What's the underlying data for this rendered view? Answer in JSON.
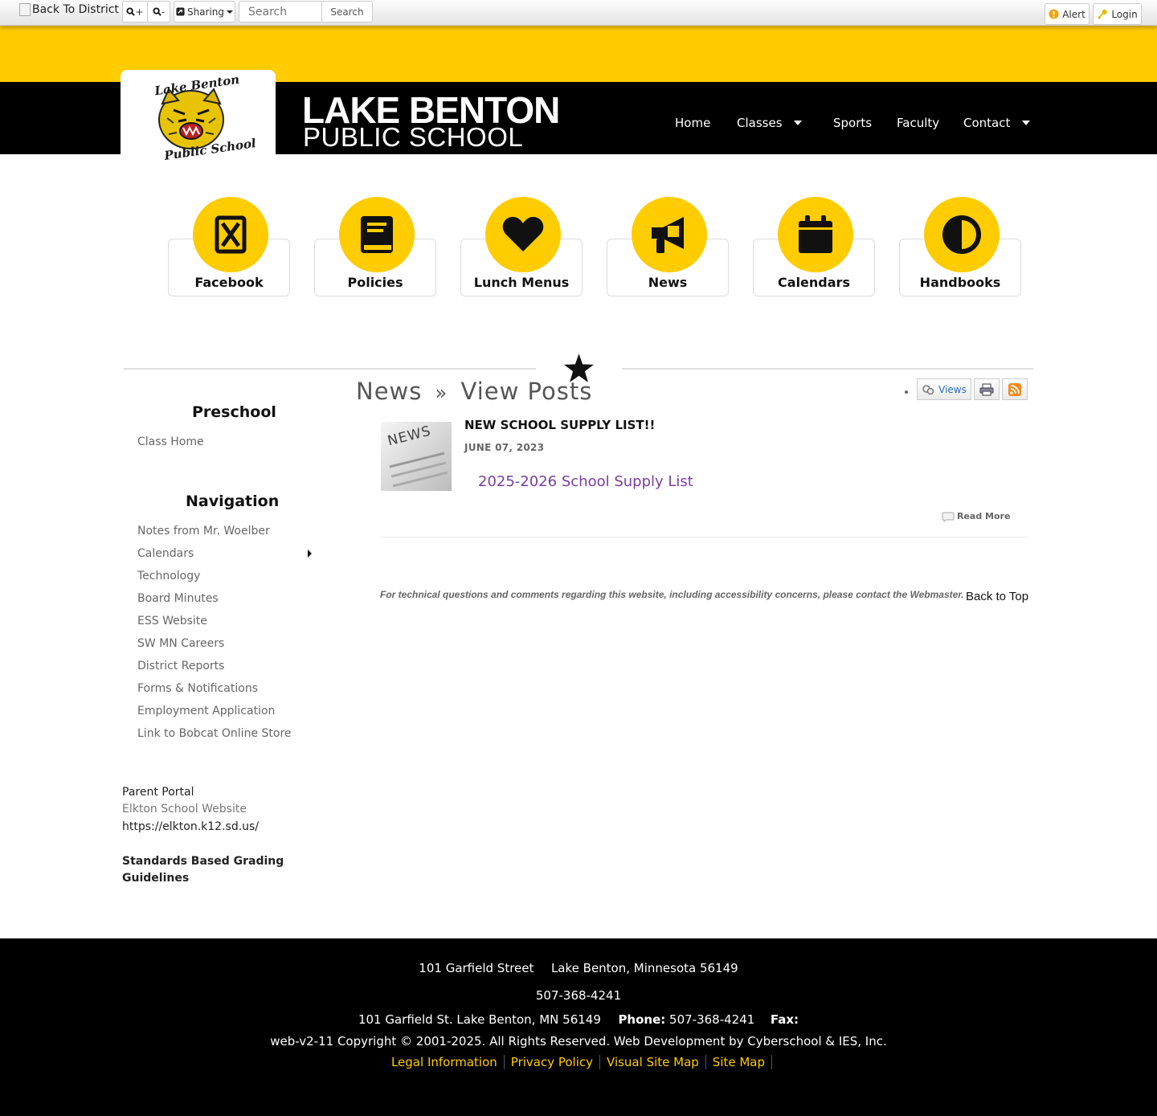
{
  "toolbar": {
    "back_label": "Back To District",
    "zoom_in": "+",
    "zoom_out": "-",
    "sharing": "Sharing",
    "search_placeholder": "Search",
    "search_button": "Search",
    "alert": "Alert",
    "login": "Login"
  },
  "header": {
    "logo_line1": "Lake Benton",
    "logo_line2": "Public School",
    "brand_line1": "LAKE BENTON",
    "brand_line2": "PUBLIC SCHOOL",
    "nav": [
      "Home",
      "Classes",
      "Sports",
      "Faculty",
      "Contact"
    ]
  },
  "quicklinks": [
    {
      "label": "Facebook",
      "icon": "facebook-icon"
    },
    {
      "label": "Policies",
      "icon": "book-icon"
    },
    {
      "label": "Lunch Menus",
      "icon": "heart-icon"
    },
    {
      "label": "News",
      "icon": "megaphone-icon"
    },
    {
      "label": "Calendars",
      "icon": "calendar-icon"
    },
    {
      "label": "Handbooks",
      "icon": "contrast-icon"
    }
  ],
  "page": {
    "title_part1": "News",
    "separator": "»",
    "title_part2": "View Posts",
    "views_label": "Views"
  },
  "sidebar": {
    "preschool_heading": "Preschool",
    "preschool_links": [
      "Class Home"
    ],
    "nav_heading": "Navigation",
    "nav_links": [
      "Notes from Mr. Woelber",
      "Calendars",
      "Technology",
      "Board Minutes",
      "ESS Website",
      "SW MN Careers",
      "District Reports",
      "Forms & Notifications",
      "Employment Application",
      "Link to Bobcat Online Store"
    ],
    "parent_portal": "Parent Portal",
    "elkton": "Elkton School Website",
    "elkton_url": "https://elkton.k12.sd.us/",
    "grading_line1": "Standards Based Grading",
    "grading_line2": "Guidelines"
  },
  "post": {
    "thumb_text": "NEWS",
    "title": "NEW SCHOOL SUPPLY LIST!!",
    "date": "JUNE 07, 2023",
    "link": "2025-2026 School Supply List",
    "read_more": "Read More"
  },
  "notice": {
    "tech": "For technical questions and comments regarding this website, including accessibility concerns, please contact the Webmaster.",
    "back_to_top": "Back to Top"
  },
  "footer": {
    "address_street": "101 Garfield Street",
    "address_city": "Lake Benton, Minnesota 56149",
    "phone": "507-368-4241",
    "contact_address": "101 Garfield St. Lake Benton, MN 56149",
    "phone_label": "Phone:",
    "phone_value": "507-368-4241",
    "fax_label": "Fax:",
    "copyright": "web-v2-11 Copyright © 2001-2025. All Rights Reserved. Web Development by Cyberschool & IES, Inc.",
    "links": [
      "Legal Information",
      "Privacy Policy",
      "Visual Site Map",
      "Site Map"
    ]
  },
  "colors": {
    "accent": "#ffcc00",
    "header_bg": "#000000",
    "link_purple": "#7a3d9c"
  }
}
